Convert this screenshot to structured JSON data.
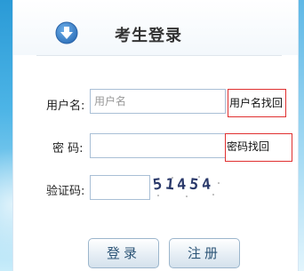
{
  "header": {
    "title": "考生登录",
    "icon": "download-arrow-icon",
    "icon_color": "#3c7fc8"
  },
  "form": {
    "username": {
      "label": "用户名:",
      "placeholder": "用户名",
      "value": "",
      "recover_link": "用户名找回"
    },
    "password": {
      "label": "密 码:",
      "value": "",
      "recover_link": "密码找回"
    },
    "captcha": {
      "label": "验证码:",
      "value": "",
      "digits": [
        "5",
        "1",
        "4",
        "5",
        "4"
      ]
    }
  },
  "buttons": {
    "login": "登录",
    "register": "注册"
  },
  "colors": {
    "link_border": "#e03030",
    "input_border": "#a9bfd6",
    "button_text": "#2d5577"
  }
}
